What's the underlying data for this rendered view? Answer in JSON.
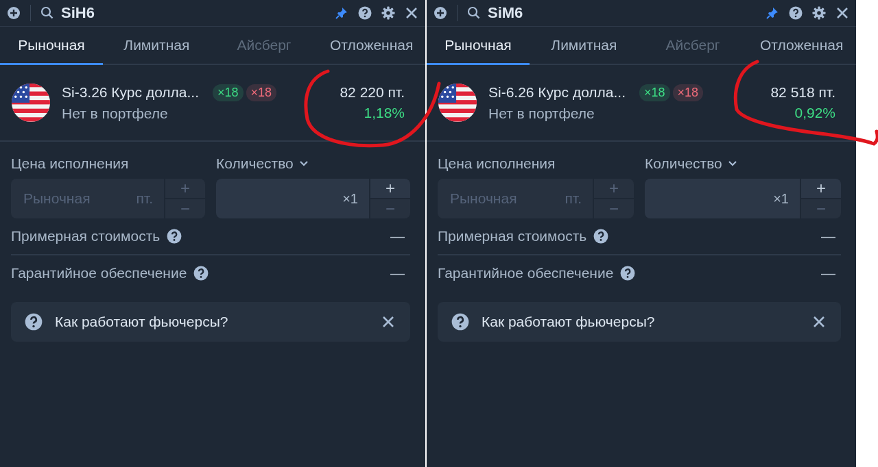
{
  "panels": [
    {
      "search": {
        "value": "SiH6"
      },
      "tabs": [
        {
          "label": "Рыночная",
          "selected": true,
          "disabled": false
        },
        {
          "label": "Лимитная",
          "selected": false,
          "disabled": false
        },
        {
          "label": "Айсберг",
          "selected": false,
          "disabled": true
        },
        {
          "label": "Отложенная",
          "selected": false,
          "disabled": false
        }
      ],
      "instrument": {
        "name": "Si-3.26 Курс долла...",
        "status": "Нет в портфеле",
        "badges": [
          {
            "label": "×18",
            "color": "#3ddc84"
          },
          {
            "label": "×18",
            "color": "#f06b7a"
          }
        ],
        "price": "82 220 пт.",
        "change": "1,18%"
      },
      "price_field": {
        "label": "Цена исполнения",
        "placeholder": "Рыночная",
        "unit": "пт.",
        "plus": "+",
        "minus": "−"
      },
      "quantity_field": {
        "label": "Количество",
        "value": "×1",
        "plus": "+",
        "minus": "−"
      },
      "rows": [
        {
          "label": "Примерная стоимость",
          "value": "—"
        },
        {
          "label": "Гарантийное обеспечение",
          "value": "—"
        }
      ],
      "info": {
        "text": "Как работают фьючерсы?"
      }
    },
    {
      "search": {
        "value": "SiM6"
      },
      "tabs": [
        {
          "label": "Рыночная",
          "selected": true,
          "disabled": false
        },
        {
          "label": "Лимитная",
          "selected": false,
          "disabled": false
        },
        {
          "label": "Айсберг",
          "selected": false,
          "disabled": true
        },
        {
          "label": "Отложенная",
          "selected": false,
          "disabled": false
        }
      ],
      "instrument": {
        "name": "Si-6.26 Курс долла...",
        "status": "Нет в портфеле",
        "badges": [
          {
            "label": "×18",
            "color": "#3ddc84"
          },
          {
            "label": "×18",
            "color": "#f06b7a"
          }
        ],
        "price": "82 518 пт.",
        "change": "0,92%"
      },
      "price_field": {
        "label": "Цена исполнения",
        "placeholder": "Рыночная",
        "unit": "пт.",
        "plus": "+",
        "minus": "−"
      },
      "quantity_field": {
        "label": "Количество",
        "value": "×1",
        "plus": "+",
        "minus": "−"
      },
      "rows": [
        {
          "label": "Примерная стоимость",
          "value": "—"
        },
        {
          "label": "Гарантийное обеспечение",
          "value": "—"
        }
      ],
      "info": {
        "text": "Как работают фьючерсы?"
      }
    }
  ]
}
